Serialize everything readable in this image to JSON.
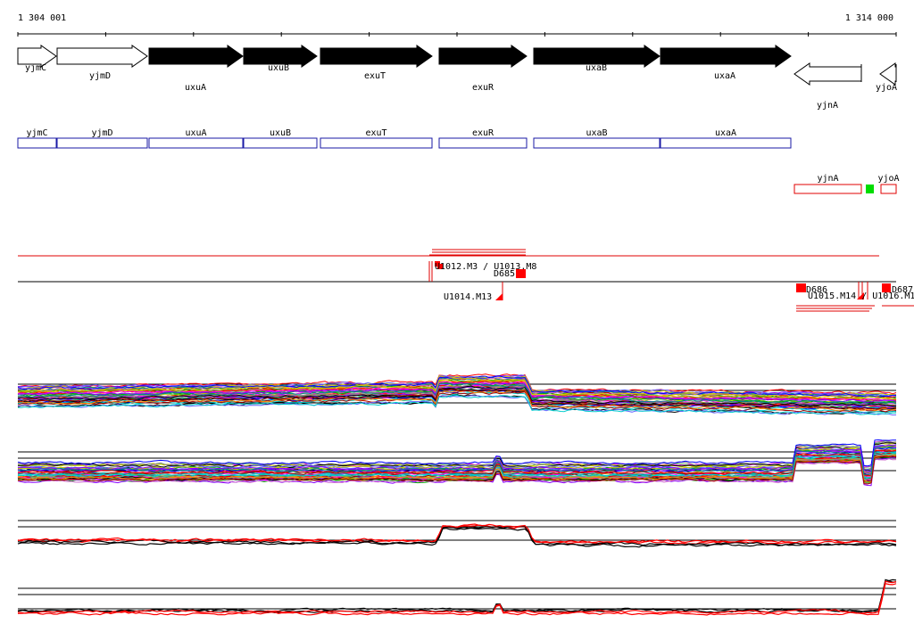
{
  "coords": {
    "start_label": "1 304 001",
    "end_label": "1 314 000"
  },
  "colors": {
    "box_blue": "#1a1aa6",
    "box_red": "#e00000",
    "marker_red": "#ff0000",
    "green": "#00dd00",
    "gene_fill_solid": "#000000",
    "gene_fill_open": "#ffffff"
  },
  "genes": [
    {
      "name": "yjmC",
      "strand": "+",
      "filled": false
    },
    {
      "name": "yjmD",
      "strand": "+",
      "filled": false
    },
    {
      "name": "uxuA",
      "strand": "+",
      "filled": true
    },
    {
      "name": "uxuB",
      "strand": "+",
      "filled": true
    },
    {
      "name": "exuT",
      "strand": "+",
      "filled": true
    },
    {
      "name": "exuR",
      "strand": "+",
      "filled": true
    },
    {
      "name": "uxaB",
      "strand": "+",
      "filled": true
    },
    {
      "name": "uxaA",
      "strand": "+",
      "filled": true
    },
    {
      "name": "yjnA",
      "strand": "-",
      "filled": false
    },
    {
      "name": "yjoA",
      "strand": "-",
      "filled": false
    }
  ],
  "forward_boxes": [
    "yjmC",
    "yjmD",
    "uxuA",
    "uxuB",
    "exuT",
    "exuR",
    "uxaB",
    "uxaA"
  ],
  "reverse_boxes": [
    "yjnA",
    "yjoA"
  ],
  "markers": {
    "stack_top": "U1012.M3 / U1013.M8",
    "d685": "D685",
    "m13": "U1014.M13",
    "d686": "D686",
    "stack_bottom": "U1015.M14 / U1016.M15",
    "d687": "D687"
  }
}
